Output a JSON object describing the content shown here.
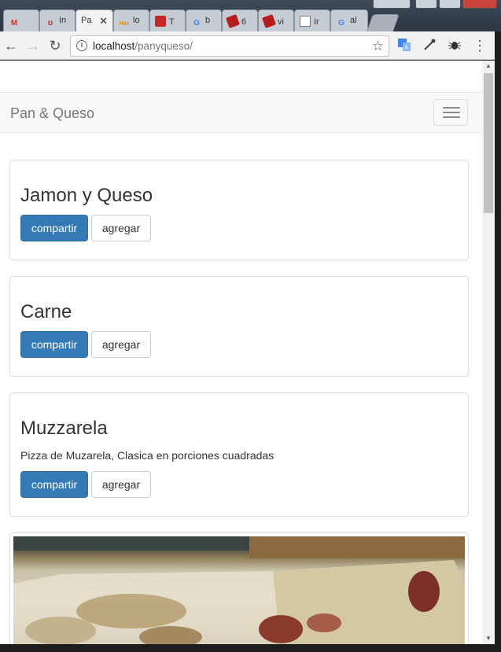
{
  "browser": {
    "tabs": [
      {
        "icon": "gmail-icon",
        "label": "M",
        "title": ""
      },
      {
        "icon": "pinterest-icon",
        "label": "ʊ",
        "title": "In"
      },
      {
        "icon": "page-icon",
        "label": "",
        "title": "Pa"
      },
      {
        "icon": "phpmyadmin-icon",
        "label": "PMA",
        "title": "lo"
      },
      {
        "icon": "app-icon",
        "label": "",
        "title": "T"
      },
      {
        "icon": "google-icon",
        "label": "G",
        "title": "b"
      },
      {
        "icon": "book-icon",
        "label": "",
        "title": "6"
      },
      {
        "icon": "book-icon",
        "label": "",
        "title": "vi"
      },
      {
        "icon": "document-icon",
        "label": "",
        "title": "Ir"
      },
      {
        "icon": "google-icon",
        "label": "G",
        "title": "al"
      }
    ],
    "active_tab_index": 2,
    "url_host": "localhost",
    "url_path": "/panyqueso/",
    "icons": {
      "back": "←",
      "forward": "→",
      "reload": "↻",
      "star": "☆",
      "menu": "⋮",
      "info": "i"
    }
  },
  "navbar": {
    "brand": "Pan & Queso"
  },
  "products": [
    {
      "name": "Jamon y Queso",
      "description": "",
      "share_label": "compartir",
      "add_label": "agregar"
    },
    {
      "name": "Carne",
      "description": "",
      "share_label": "compartir",
      "add_label": "agregar"
    },
    {
      "name": "Muzzarela",
      "description": "Pizza de Muzarela, Clasica en porciones cuadradas",
      "share_label": "compartir",
      "add_label": "agregar"
    }
  ],
  "colors": {
    "primary": "#337ab7",
    "navbar_bg": "#f8f8f8",
    "brand_text": "#777777"
  }
}
